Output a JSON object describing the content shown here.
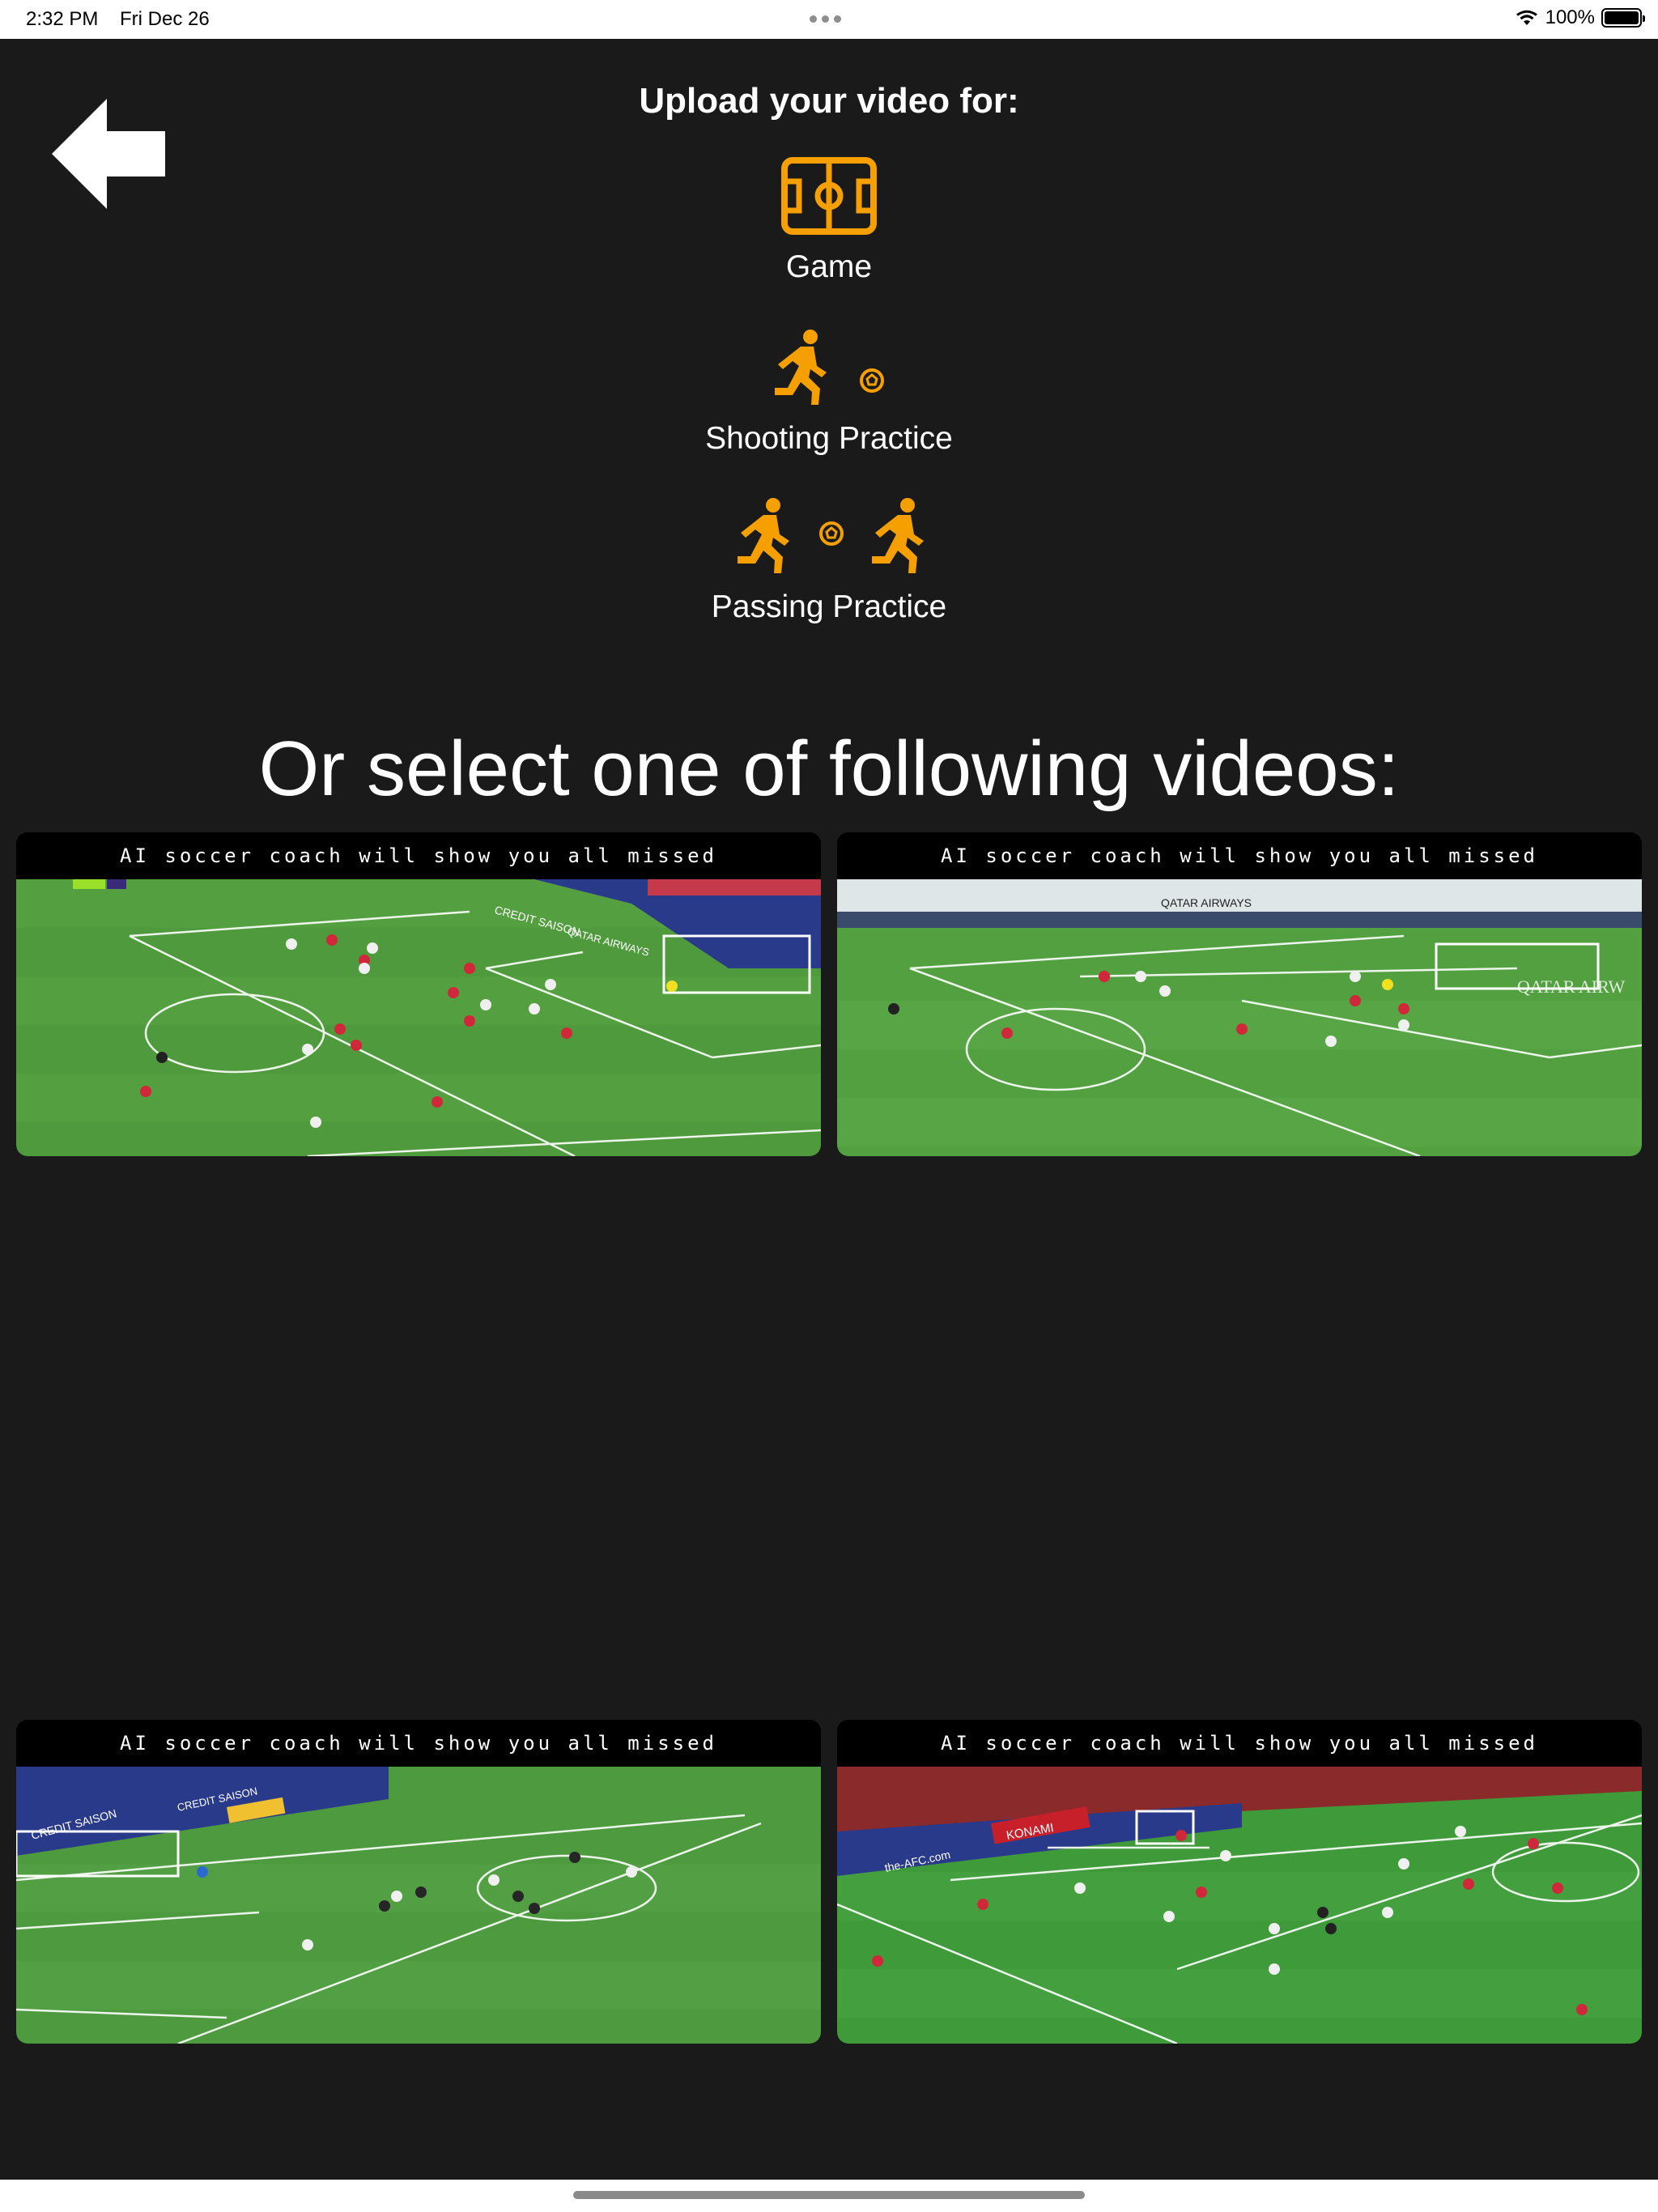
{
  "status_bar": {
    "time": "2:32 PM",
    "date": "Fri Dec 26",
    "battery": "100%"
  },
  "header": {
    "upload_title": "Upload your video for:"
  },
  "options": [
    {
      "label": "Game",
      "icon": "soccer-field-icon"
    },
    {
      "label": "Shooting Practice",
      "icon": "runner-ball-icon"
    },
    {
      "label": "Passing Practice",
      "icon": "runner-ball-runner-icon"
    }
  ],
  "accent_color": "#f5a000",
  "section_title": "Or select one of following videos:",
  "videos": [
    {
      "caption": "AI soccer coach will show you all missed opportunities",
      "team_color": "#c8202b"
    },
    {
      "caption": "AI soccer coach will show you all missed opportunities",
      "team_color": "#c8202b"
    },
    {
      "caption": "AI soccer coach will show you all missed opportunities",
      "team_color": "#222222"
    },
    {
      "caption": "AI soccer coach will show you all missed opportunities",
      "team_color": "#c8202b"
    }
  ]
}
